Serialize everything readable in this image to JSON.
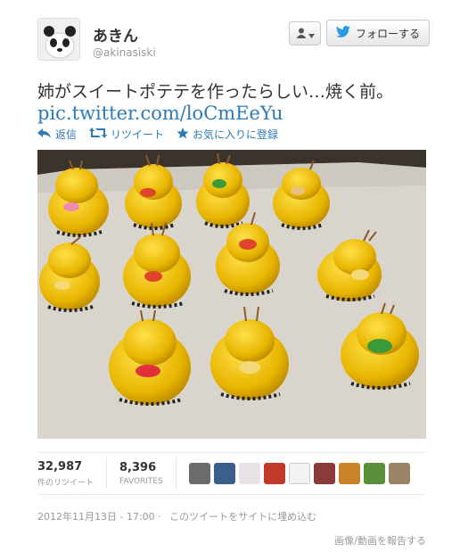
{
  "user": {
    "display_name": "あきん",
    "handle": "@akinasiski"
  },
  "header": {
    "user_menu_icon": "person-dropdown-icon",
    "follow_label": "フォローする",
    "follow_icon": "twitter-bird-icon"
  },
  "tweet": {
    "text": "姉がスイートポテテを作ったらしい…焼く前。",
    "link": "pic.twitter.com/loCmEeYu"
  },
  "actions": {
    "reply": "返信",
    "retweet": "リツイート",
    "favorite": "お気に入りに登録"
  },
  "stats": {
    "retweets_count": "32,987",
    "retweets_label": "件のリツイート",
    "favorites_count": "8,396",
    "favorites_label": "FAVORITES"
  },
  "footer": {
    "timestamp": "2012年11月13日 - 17:00",
    "embed": "このツイートをサイトに埋め込む",
    "report": "画像/動画を報告する"
  },
  "colors": {
    "link": "#2b7bb9",
    "chick": "#f2c200",
    "tray_paper": "#d8d4cc"
  }
}
